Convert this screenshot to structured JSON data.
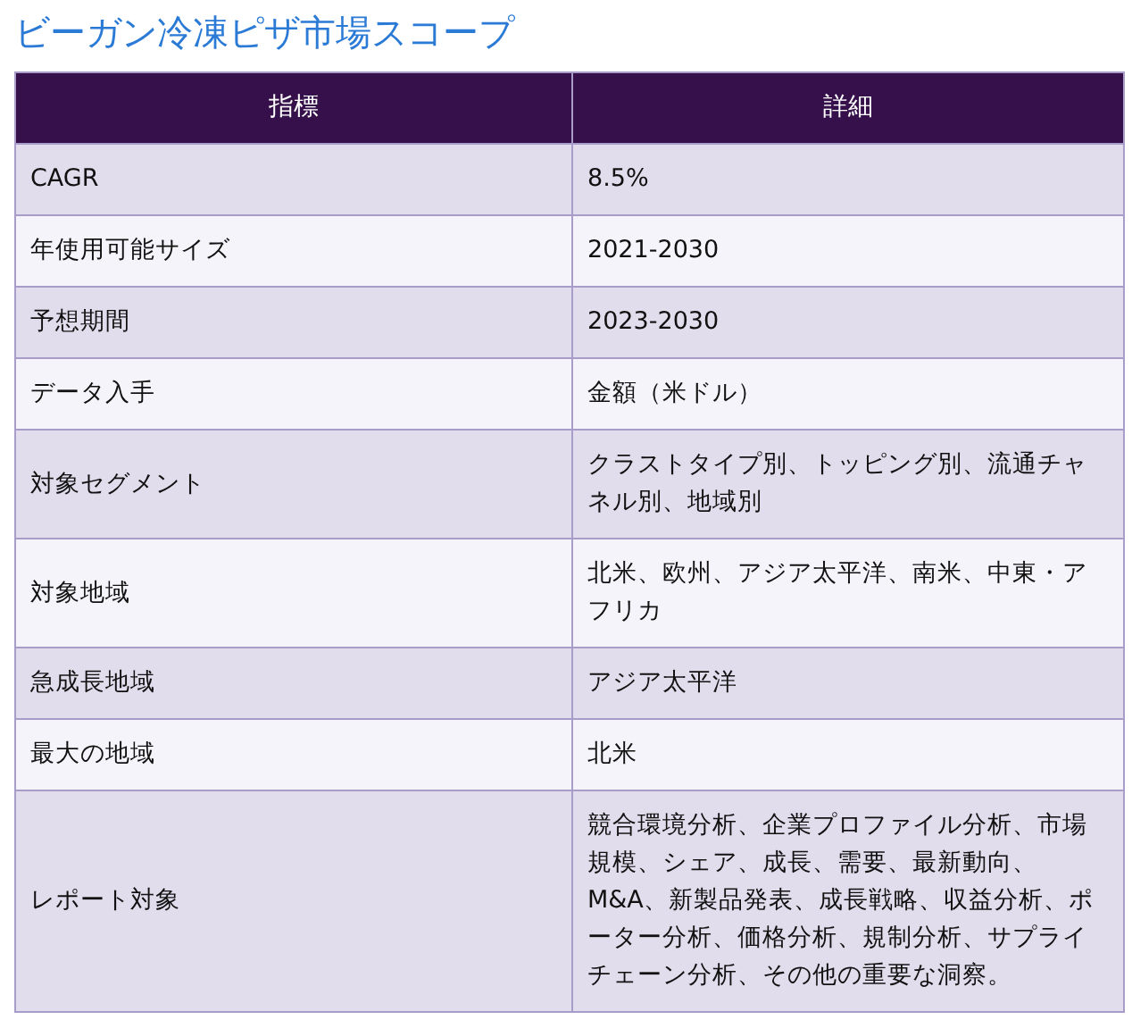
{
  "title": "ビーガン冷凍ピザ市場スコープ",
  "table": {
    "columns": [
      "指標",
      "詳細"
    ],
    "rows": [
      [
        "CAGR",
        "8.5%"
      ],
      [
        "年使用可能サイズ",
        "2021-2030"
      ],
      [
        "予想期間",
        "2023-2030"
      ],
      [
        "データ入手",
        "金額（米ドル）"
      ],
      [
        "対象セグメント",
        "クラストタイプ別、トッピング別、流通チャネル別、地域別"
      ],
      [
        "対象地域",
        "北米、欧州、アジア太平洋、南米、中東・アフリカ"
      ],
      [
        "急成長地域",
        "アジア太平洋"
      ],
      [
        "最大の地域",
        "北米"
      ],
      [
        "レポート対象",
        "競合環境分析、企業プロファイル分析、市場規模、シェア、成長、需要、最新動向、M&A、新製品発表、成長戦略、収益分析、ポーター分析、価格分析、規制分析、サプライチェーン分析、その他の重要な洞察。"
      ]
    ]
  }
}
